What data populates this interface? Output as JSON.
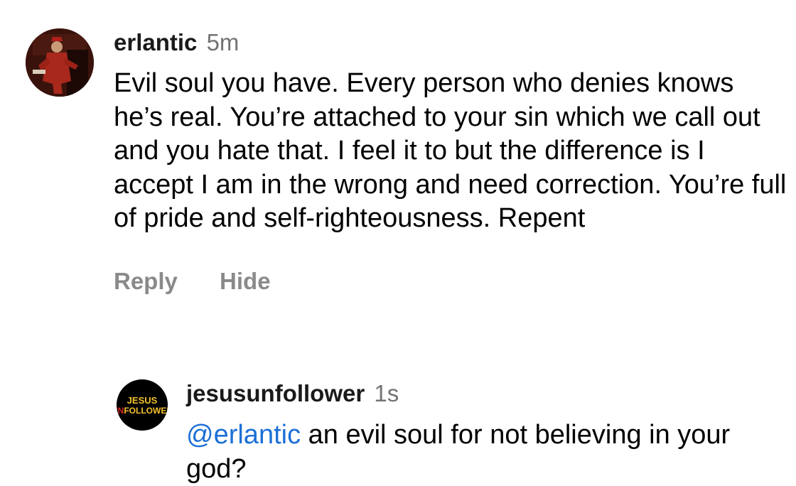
{
  "comments": [
    {
      "username": "erlantic",
      "time": "5m",
      "text": "Evil soul you have. Every person who denies knows he’s real. You’re attached to your sin which we call out and you hate that. I feel it to but the difference is I accept I am in the wrong and need correction. You’re full of pride and self-righteousness. Repent",
      "actions": {
        "reply": "Reply",
        "hide": "Hide"
      }
    }
  ],
  "reply": {
    "username": "jesusunfollower",
    "time": "1s",
    "mention": "@erlantic",
    "text": " an evil soul for not believing in your god?",
    "avatar_logo": {
      "line1": "JESUS",
      "line2_prefix": "UN",
      "line2_rest": "FOLLOWER"
    }
  },
  "colors": {
    "mention": "#1c6fd6",
    "timestamp": "#737373",
    "action": "#8a8a8a",
    "logo_yellow": "#f2c12e",
    "logo_red": "#d6281f"
  },
  "icons": {
    "main_avatar": "avatar-red-figure-painting",
    "reply_avatar": "avatar-jesus-unfollower-logo"
  }
}
